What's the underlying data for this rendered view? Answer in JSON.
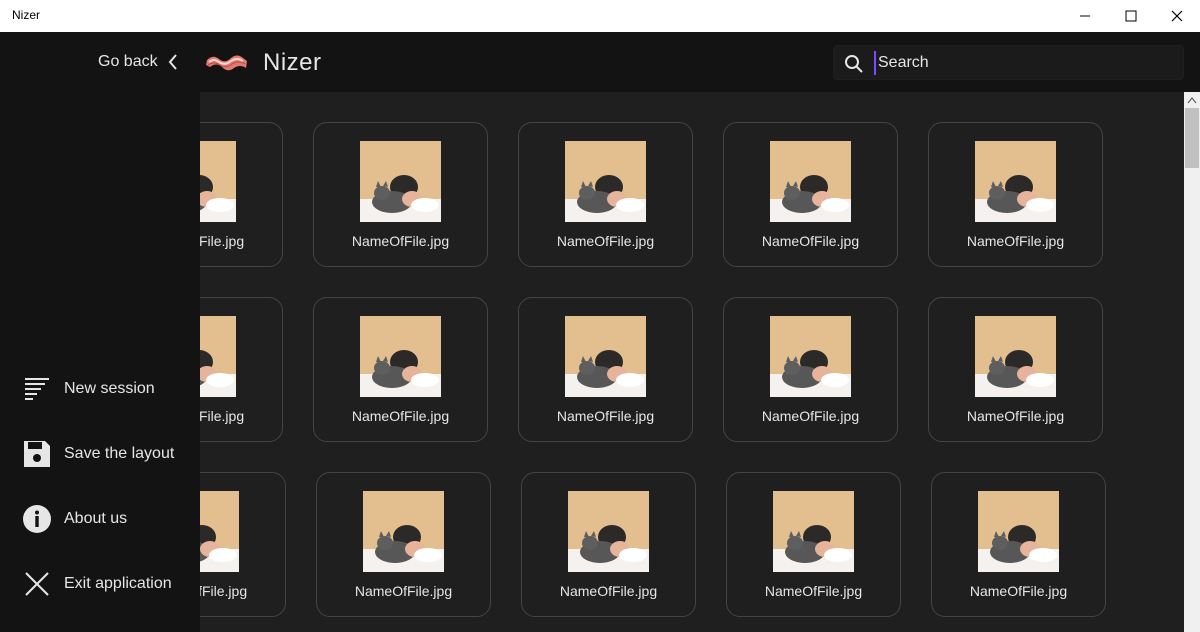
{
  "window": {
    "title": "Nizer"
  },
  "header": {
    "go_back_label": "Go back",
    "app_name": "Nizer",
    "search_placeholder": "Search"
  },
  "sidebar": {
    "items": [
      {
        "label": "New session",
        "icon": "list-lines-icon"
      },
      {
        "label": "Save the layout",
        "icon": "floppy-disk-icon"
      },
      {
        "label": "About us",
        "icon": "info-icon"
      },
      {
        "label": "Exit application",
        "icon": "close-icon"
      }
    ]
  },
  "files": {
    "rows": [
      [
        "NameOfFile.jpg",
        "NameOfFile.jpg",
        "NameOfFile.jpg",
        "NameOfFile.jpg",
        "NameOfFile.jpg"
      ],
      [
        "NameOfFile.jpg",
        "NameOfFile.jpg",
        "NameOfFile.jpg",
        "NameOfFile.jpg",
        "NameOfFile.jpg"
      ],
      [
        "NameOfFile.jpg",
        "NameOfFile.jpg",
        "NameOfFile.jpg",
        "NameOfFile.jpg",
        "NameOfFile.jpg"
      ]
    ]
  },
  "colors": {
    "accent": "#7b4cff",
    "sidebar_bg": "#131313",
    "content_bg": "#1f1f1f",
    "thumb_bg": "#e3bf8f"
  }
}
